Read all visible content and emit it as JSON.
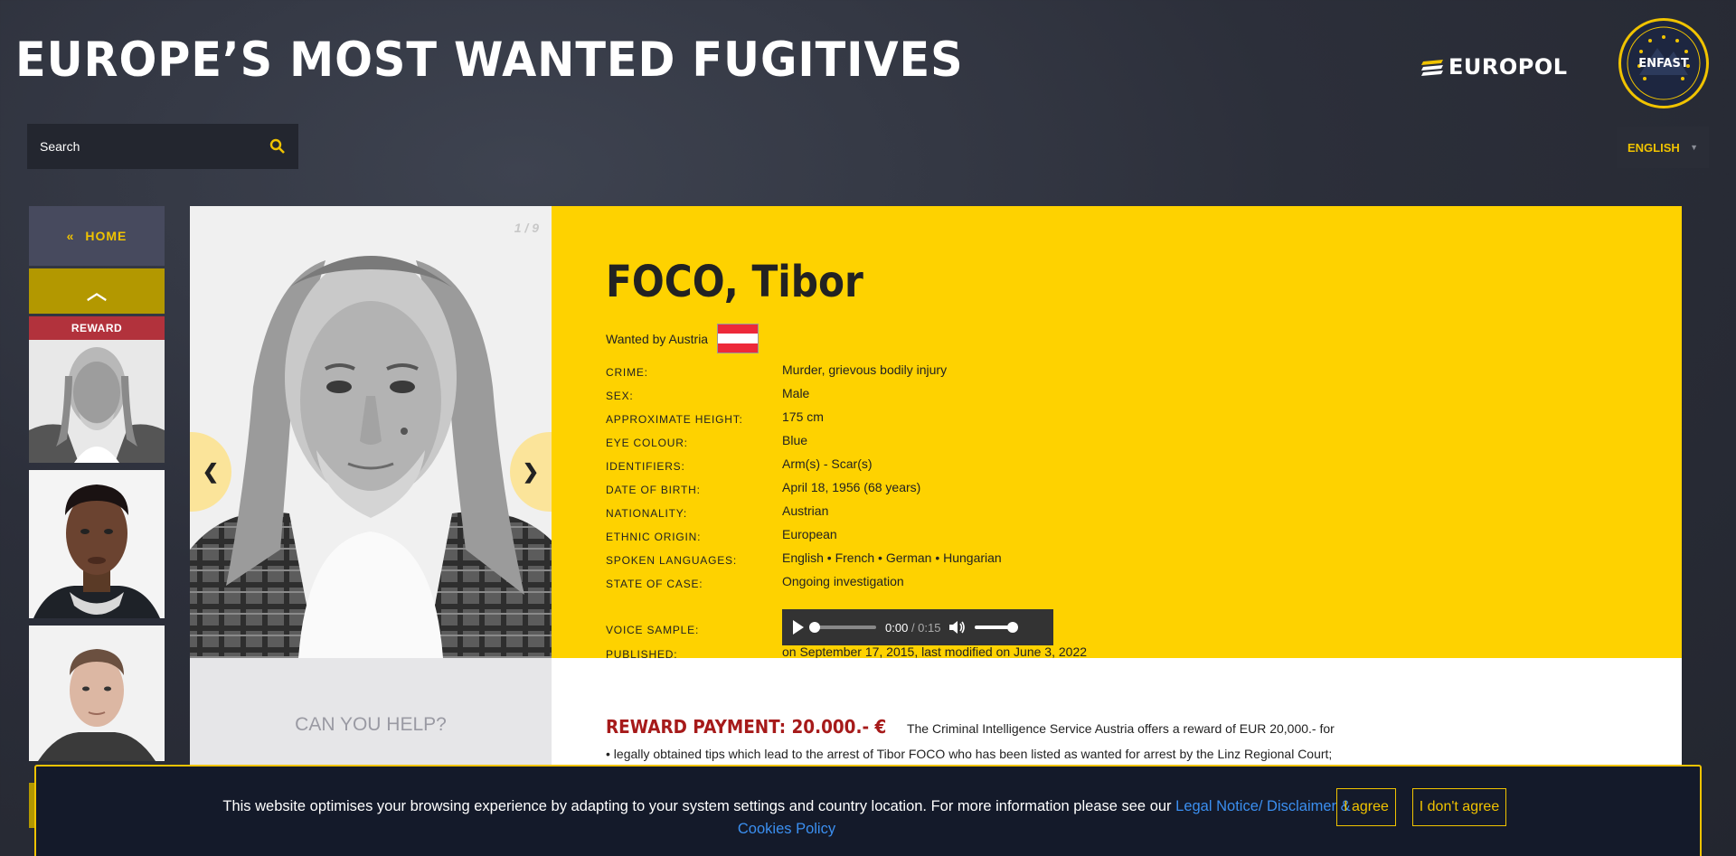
{
  "header": {
    "site_title": "EUROPE’S MOST WANTED FUGITIVES",
    "europol_logo_text": "EUROPOL",
    "enfast_logo_text": "ENFAST"
  },
  "search": {
    "placeholder": "Search"
  },
  "language": {
    "selected": "ENGLISH"
  },
  "sidebar": {
    "home_label": "HOME",
    "home_glyph": "«",
    "up_glyph": "︿",
    "reward_tag": "REWARD"
  },
  "photo": {
    "counter": "1 / 9"
  },
  "fugitive": {
    "name": "FOCO, Tibor",
    "wanted_by": "Wanted by Austria",
    "flag_colors": [
      "#ed2939",
      "#ffffff",
      "#ed2939"
    ],
    "facts": [
      {
        "label": "CRIME:",
        "value": "Murder, grievous bodily injury"
      },
      {
        "label": "SEX:",
        "value": "Male"
      },
      {
        "label": "APPROXIMATE HEIGHT:",
        "value": "175 cm"
      },
      {
        "label": "EYE COLOUR:",
        "value": "Blue"
      },
      {
        "label": "IDENTIFIERS:",
        "value": "Arm(s) - Scar(s)"
      },
      {
        "label": "DATE OF BIRTH:",
        "value": "April 18, 1956 (68 years)"
      },
      {
        "label": "NATIONALITY:",
        "value": "Austrian"
      },
      {
        "label": "ETHNIC ORIGIN:",
        "value": "European"
      },
      {
        "label": "SPOKEN LANGUAGES:",
        "value": "English • French • German • Hungarian"
      },
      {
        "label": "STATE OF CASE:",
        "value": "Ongoing investigation"
      }
    ],
    "voice_label": "VOICE SAMPLE:",
    "audio": {
      "current": "0:00",
      "duration": "/ 0:15"
    },
    "published_label": "PUBLISHED:",
    "published_value": "on September 17, 2015, last modified on June 3, 2022"
  },
  "help": {
    "title": "CAN YOU HELP?"
  },
  "reward": {
    "heading": "REWARD PAYMENT: 20.000.- €",
    "text": "The Criminal Intelligence Service Austria offers a reward of EUR 20,000.- for",
    "bullet": "• legally obtained tips which lead to the arrest of Tibor FOCO who has been listed as wanted for arrest by the Linz Regional Court;"
  },
  "cookie": {
    "text": "This website optimises your browsing experience by adapting to your system settings and country location. For more information please see our",
    "link": "Legal Notice/ Disclaimer & Cookies Policy",
    "agree": "I agree",
    "disagree": "I don't agree"
  },
  "colors": {
    "accent": "#fed200",
    "reward_red": "#a61a1a",
    "link_blue": "#3b8ff0"
  }
}
